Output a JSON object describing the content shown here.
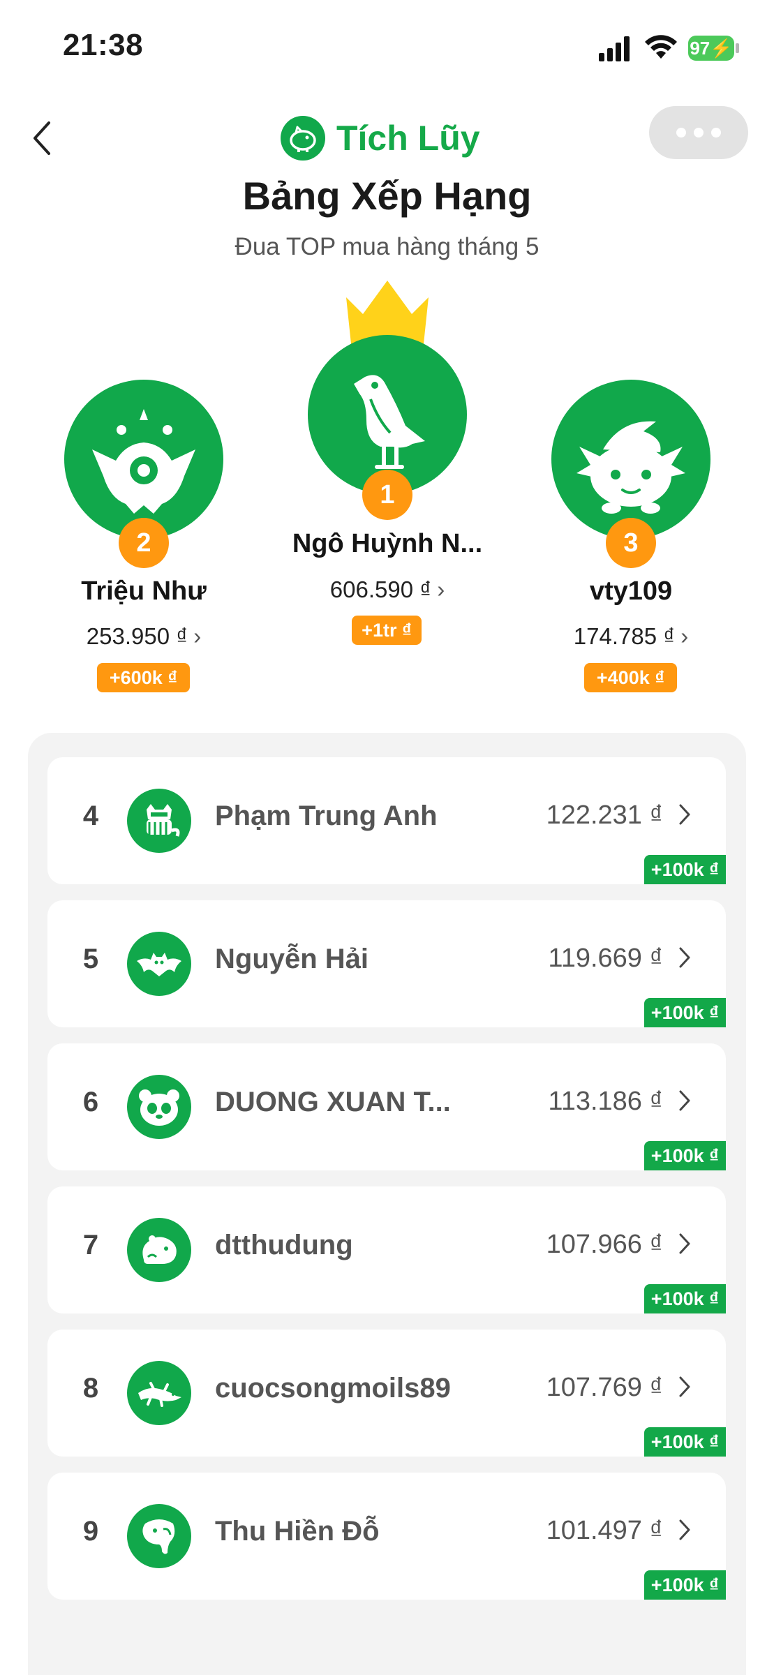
{
  "status_bar": {
    "time": "21:38",
    "battery": "97"
  },
  "header": {
    "brand_name": "Tích Lũy",
    "title": "Bảng Xếp Hạng",
    "subtitle": "Đua TOP mua hàng tháng 5",
    "icons": [
      "back-arrow-icon",
      "piggy-bank-icon",
      "more-dots-icon"
    ]
  },
  "podium": [
    {
      "rank": "1",
      "name": "Ngô Huỳnh N...",
      "amount": "606.590 ₫",
      "bonus": "+1tr ₫",
      "avatar": "bird-icon",
      "crown": "crown-icon"
    },
    {
      "rank": "2",
      "name": "Triệu Như",
      "amount": "253.950 ₫",
      "bonus": "+600k ₫",
      "avatar": "monster-icon"
    },
    {
      "rank": "3",
      "name": "vty109",
      "amount": "174.785 ₫",
      "bonus": "+400k ₫",
      "avatar": "axolotl-icon"
    }
  ],
  "leaderboard": [
    {
      "rank": "4",
      "name": "Phạm Trung Anh",
      "amount": "122.231 ₫",
      "bonus": "+100k ₫",
      "avatar": "raccoon-icon"
    },
    {
      "rank": "5",
      "name": "Nguyễn Hải",
      "amount": "119.669 ₫",
      "bonus": "+100k ₫",
      "avatar": "bat-icon"
    },
    {
      "rank": "6",
      "name": "DUONG XUAN T...",
      "amount": "113.186 ₫",
      "bonus": "+100k ₫",
      "avatar": "panda-icon"
    },
    {
      "rank": "7",
      "name": "dtthudung",
      "amount": "107.966 ₫",
      "bonus": "+100k ₫",
      "avatar": "capybara-icon"
    },
    {
      "rank": "8",
      "name": "cuocsongmoils89",
      "amount": "107.769 ₫",
      "bonus": "+100k ₫",
      "avatar": "lizard-icon"
    },
    {
      "rank": "9",
      "name": "Thu Hiền Đỗ",
      "amount": "101.497 ₫",
      "bonus": "+100k ₫",
      "avatar": "elephant-icon"
    }
  ],
  "colors": {
    "brand_green": "#11a84b",
    "badge_orange": "#ff9810",
    "crown_yellow": "#ffd21a",
    "list_bg": "#f3f3f3"
  }
}
